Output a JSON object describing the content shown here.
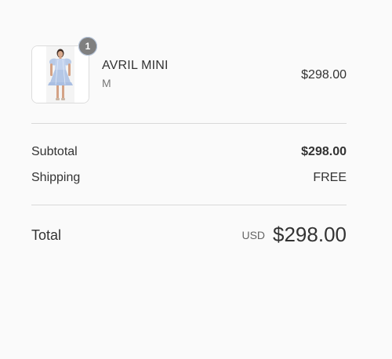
{
  "product": {
    "name": "AVRIL MINI",
    "variant": "M",
    "price": "$298.00",
    "quantity": "1",
    "image_icon": "dress-product-image"
  },
  "totals": {
    "subtotal_label": "Subtotal",
    "subtotal_value": "$298.00",
    "shipping_label": "Shipping",
    "shipping_value": "FREE",
    "total_label": "Total",
    "currency": "USD",
    "total_value": "$298.00"
  },
  "colors": {
    "background": "#fafafa",
    "text": "#333333",
    "badge": "#7f7f7f",
    "divider": "#d9d9d9"
  }
}
